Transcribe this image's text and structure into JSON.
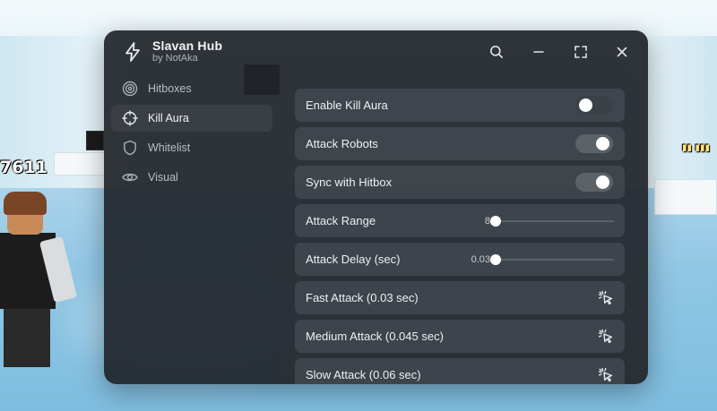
{
  "window": {
    "title": "Slavan Hub",
    "subtitle": "by NotAka",
    "controls": {
      "search": "search-icon",
      "minimize": "minimize-icon",
      "maximize": "maximize-icon",
      "close": "close-icon"
    }
  },
  "sidebar": {
    "items": [
      {
        "label": "Hitboxes",
        "icon": "target-icon",
        "active": false
      },
      {
        "label": "Kill Aura",
        "icon": "crosshair-icon",
        "active": true
      },
      {
        "label": "Whitelist",
        "icon": "shield-icon",
        "active": false
      },
      {
        "label": "Visual",
        "icon": "eye-icon",
        "active": false
      }
    ]
  },
  "main": {
    "toggles": [
      {
        "label": "Enable Kill Aura",
        "on": false
      },
      {
        "label": "Attack Robots",
        "on": true
      },
      {
        "label": "Sync with Hitbox",
        "on": true
      }
    ],
    "sliders": [
      {
        "label": "Attack Range",
        "value": "8",
        "fraction": 0.0
      },
      {
        "label": "Attack Delay (sec)",
        "value": "0.03",
        "fraction": 0.0
      }
    ],
    "buttons": [
      {
        "label": "Fast Attack (0.03 sec)",
        "icon": "click-icon"
      },
      {
        "label": "Medium Attack (0.045 sec)",
        "icon": "click-icon"
      },
      {
        "label": "Slow Attack (0.06 sec)",
        "icon": "click-icon"
      }
    ]
  },
  "background": {
    "player_tag": "7611"
  },
  "colors": {
    "window_bg": "#20252a",
    "row_bg": "#464d54",
    "toggle_on": "#5b6368",
    "text": "#eef1f3"
  }
}
